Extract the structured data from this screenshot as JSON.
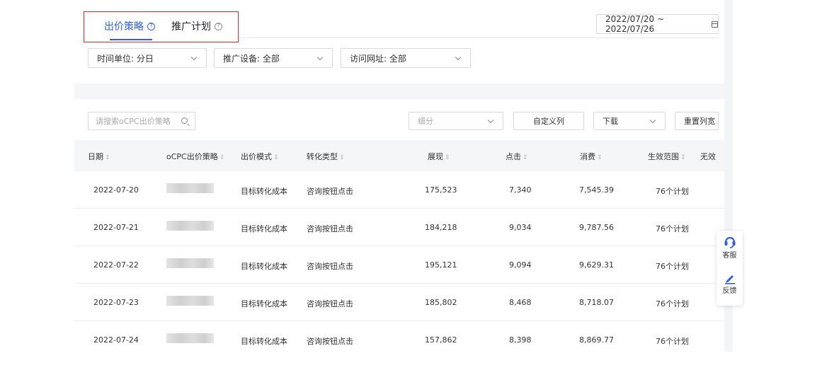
{
  "tabs": [
    {
      "label": "出价策略",
      "help": "?",
      "active": true
    },
    {
      "label": "推广计划",
      "help": "?",
      "active": false
    }
  ],
  "date_range": "2022/07/20 ~ 2022/07/26",
  "filters": {
    "time_unit": "时间单位: 分日",
    "device": "推广设备: 全部",
    "url": "访问网址: 全部"
  },
  "toolbar": {
    "search_placeholder": "请搜索oCPC出价策略",
    "segment_placeholder": "细分",
    "custom_columns": "自定义列",
    "download": "下载",
    "reset_width": "重置列宽"
  },
  "table": {
    "columns": [
      "日期",
      "oCPC出价策略",
      "出价模式",
      "转化类型",
      "展现",
      "点击",
      "消费",
      "生效范围",
      "无效"
    ],
    "rows": [
      {
        "date": "2022-07-20",
        "mode": "目标转化成本",
        "type": "咨询按钮点击",
        "impressions": "175,523",
        "clicks": "7,340",
        "cost": "7,545.39",
        "scope": "76个计划"
      },
      {
        "date": "2022-07-21",
        "mode": "目标转化成本",
        "type": "咨询按钮点击",
        "impressions": "184,218",
        "clicks": "9,034",
        "cost": "9,787.56",
        "scope": "76个计划"
      },
      {
        "date": "2022-07-22",
        "mode": "目标转化成本",
        "type": "咨询按钮点击",
        "impressions": "195,121",
        "clicks": "9,094",
        "cost": "9,629.31",
        "scope": "76个计划"
      },
      {
        "date": "2022-07-23",
        "mode": "目标转化成本",
        "type": "咨询按钮点击",
        "impressions": "185,802",
        "clicks": "8,468",
        "cost": "8,718.07",
        "scope": "76个计划"
      },
      {
        "date": "2022-07-24",
        "mode": "目标转化成本",
        "type": "咨询按钮点击",
        "impressions": "157,862",
        "clicks": "8,398",
        "cost": "8,869.77",
        "scope": "76个计划"
      }
    ]
  },
  "side": {
    "service_label": "客服",
    "feedback_label": "反馈",
    "service_icon": "headset-icon",
    "feedback_icon": "pencil-icon"
  },
  "colors": {
    "accent": "#2f5fe4",
    "highlight_box": "#e5272d"
  }
}
